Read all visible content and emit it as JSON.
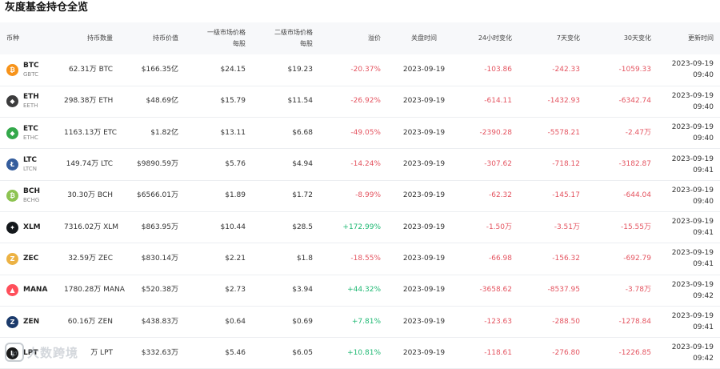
{
  "page_title": "灰度基金持仓全览",
  "headers": {
    "coin": "币种",
    "holdings": "持币数量",
    "value": "持币价值",
    "primary_line1": "一级市场价格",
    "primary_line2": "每股",
    "secondary_line1": "二级市场价格",
    "secondary_line2": "每股",
    "premium": "溢价",
    "close_time": "关盘时间",
    "change_24h": "24小时变化",
    "change_7d": "7天变化",
    "change_30d": "30天变化",
    "updated": "更新时间"
  },
  "rows": [
    {
      "symbol": "BTC",
      "sub": "GBTC",
      "icon": "btc-icon",
      "color": "#f7931a",
      "glyph": "₿",
      "holdings": "62.31万 BTC",
      "value": "$166.35亿",
      "primary": "$24.15",
      "secondary": "$19.23",
      "premium": "-20.37%",
      "premium_sign": "neg",
      "close": "2023-09-19",
      "c24": "-103.86",
      "c7": "-242.33",
      "c30": "-1059.33",
      "upd_date": "2023-09-19",
      "upd_time": "09:40"
    },
    {
      "symbol": "ETH",
      "sub": "EETH",
      "icon": "eth-icon",
      "color": "#3c3c3d",
      "glyph": "◆",
      "holdings": "298.38万 ETH",
      "value": "$48.69亿",
      "primary": "$15.79",
      "secondary": "$11.54",
      "premium": "-26.92%",
      "premium_sign": "neg",
      "close": "2023-09-19",
      "c24": "-614.11",
      "c7": "-1432.93",
      "c30": "-6342.74",
      "upd_date": "2023-09-19",
      "upd_time": "09:40"
    },
    {
      "symbol": "ETC",
      "sub": "ETHC",
      "icon": "etc-icon",
      "color": "#33a84a",
      "glyph": "◆",
      "holdings": "1163.13万 ETC",
      "value": "$1.82亿",
      "primary": "$13.11",
      "secondary": "$6.68",
      "premium": "-49.05%",
      "premium_sign": "neg",
      "close": "2023-09-19",
      "c24": "-2390.28",
      "c7": "-5578.21",
      "c30": "-2.47万",
      "upd_date": "2023-09-19",
      "upd_time": "09:40"
    },
    {
      "symbol": "LTC",
      "sub": "LTCN",
      "icon": "ltc-icon",
      "color": "#345d9d",
      "glyph": "Ł",
      "holdings": "149.74万 LTC",
      "value": "$9890.59万",
      "primary": "$5.76",
      "secondary": "$4.94",
      "premium": "-14.24%",
      "premium_sign": "neg",
      "close": "2023-09-19",
      "c24": "-307.62",
      "c7": "-718.12",
      "c30": "-3182.87",
      "upd_date": "2023-09-19",
      "upd_time": "09:41"
    },
    {
      "symbol": "BCH",
      "sub": "BCHG",
      "icon": "bch-icon",
      "color": "#8dc351",
      "glyph": "₿",
      "holdings": "30.30万 BCH",
      "value": "$6566.01万",
      "primary": "$1.89",
      "secondary": "$1.72",
      "premium": "-8.99%",
      "premium_sign": "neg",
      "close": "2023-09-19",
      "c24": "-62.32",
      "c7": "-145.17",
      "c30": "-644.04",
      "upd_date": "2023-09-19",
      "upd_time": "09:40"
    },
    {
      "symbol": "XLM",
      "sub": "",
      "icon": "xlm-icon",
      "color": "#14181c",
      "glyph": "✦",
      "holdings": "7316.02万 XLM",
      "value": "$863.95万",
      "primary": "$10.44",
      "secondary": "$28.5",
      "premium": "+172.99%",
      "premium_sign": "pos",
      "close": "2023-09-19",
      "c24": "-1.50万",
      "c7": "-3.51万",
      "c30": "-15.55万",
      "upd_date": "2023-09-19",
      "upd_time": "09:41"
    },
    {
      "symbol": "ZEC",
      "sub": "",
      "icon": "zec-icon",
      "color": "#ecb244",
      "glyph": "Z",
      "holdings": "32.59万 ZEC",
      "value": "$830.14万",
      "primary": "$2.21",
      "secondary": "$1.8",
      "premium": "-18.55%",
      "premium_sign": "neg",
      "close": "2023-09-19",
      "c24": "-66.98",
      "c7": "-156.32",
      "c30": "-692.79",
      "upd_date": "2023-09-19",
      "upd_time": "09:41"
    },
    {
      "symbol": "MANA",
      "sub": "",
      "icon": "mana-icon",
      "color": "#ff4f5b",
      "glyph": "▲",
      "holdings": "1780.28万 MANA",
      "value": "$520.38万",
      "primary": "$2.73",
      "secondary": "$3.94",
      "premium": "+44.32%",
      "premium_sign": "pos",
      "close": "2023-09-19",
      "c24": "-3658.62",
      "c7": "-8537.95",
      "c30": "-3.78万",
      "upd_date": "2023-09-19",
      "upd_time": "09:42"
    },
    {
      "symbol": "ZEN",
      "sub": "",
      "icon": "zen-icon",
      "color": "#1b3a6b",
      "glyph": "Z",
      "holdings": "60.16万 ZEN",
      "value": "$438.83万",
      "primary": "$0.64",
      "secondary": "$0.69",
      "premium": "+7.81%",
      "premium_sign": "pos",
      "close": "2023-09-19",
      "c24": "-123.63",
      "c7": "-288.50",
      "c30": "-1278.84",
      "upd_date": "2023-09-19",
      "upd_time": "09:41"
    },
    {
      "symbol": "LPT",
      "sub": "",
      "icon": "lpt-icon",
      "color": "#1a1a1a",
      "glyph": "L",
      "holdings": "万 LPT",
      "value": "$332.63万",
      "primary": "$5.46",
      "secondary": "$6.05",
      "premium": "+10.81%",
      "premium_sign": "pos",
      "close": "2023-09-19",
      "c24": "-118.61",
      "c7": "-276.80",
      "c30": "-1226.85",
      "upd_date": "2023-09-19",
      "upd_time": "09:42"
    }
  ],
  "watermark": {
    "logo_glyph": "℘",
    "text": "大数跨境"
  }
}
